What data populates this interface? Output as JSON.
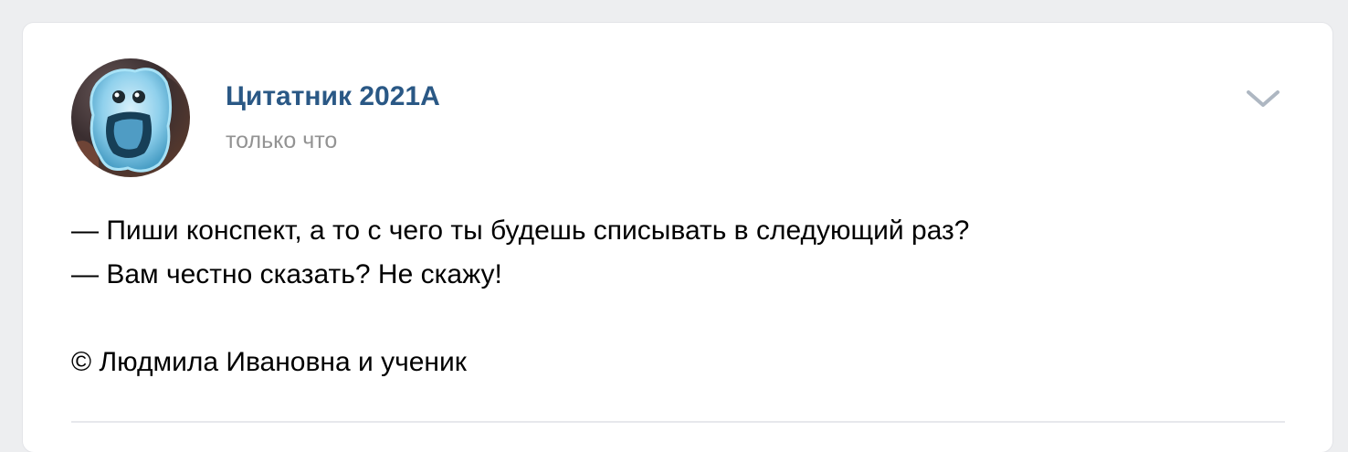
{
  "post": {
    "author": {
      "name": "Цитатник 2021А",
      "avatar": "blue-ghost-creature-avatar"
    },
    "time": "только что",
    "menu_icon": "chevron-down-icon",
    "text_lines": [
      "— Пиши конспект, а то с чего ты будешь списывать в следующий раз?",
      "— Вам честно сказать? Не скажу!",
      "",
      "© Людмила Ивановна и ученик"
    ]
  },
  "colors": {
    "page_background": "#edeef0",
    "card_background": "#ffffff",
    "author_link": "#2a5885",
    "time_text": "#939393",
    "body_text": "#000000",
    "chevron": "#aeb7c2",
    "divider": "#e7e8ec"
  }
}
